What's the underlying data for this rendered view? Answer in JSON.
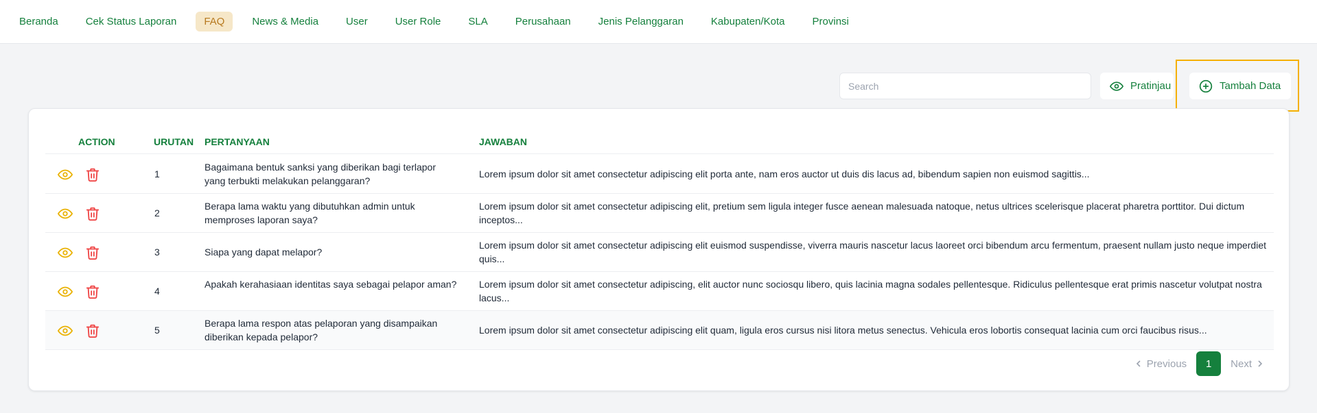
{
  "nav": {
    "items": [
      {
        "label": "Beranda"
      },
      {
        "label": "Cek Status Laporan"
      },
      {
        "label": "FAQ"
      },
      {
        "label": "News & Media"
      },
      {
        "label": "User"
      },
      {
        "label": "User Role"
      },
      {
        "label": "SLA"
      },
      {
        "label": "Perusahaan"
      },
      {
        "label": "Jenis Pelanggaran"
      },
      {
        "label": "Kabupaten/Kota"
      },
      {
        "label": "Provinsi"
      }
    ],
    "active_index": 2
  },
  "toolbar": {
    "search_placeholder": "Search",
    "search_value": "",
    "preview_label": "Pratinjau",
    "add_label": "Tambah Data"
  },
  "table": {
    "headers": {
      "action": "ACTION",
      "urutan": "URUTAN",
      "pertanyaan": "PERTANYAAN",
      "jawaban": "JAWABAN"
    },
    "rows": [
      {
        "no": "1",
        "question": "Bagaimana bentuk sanksi yang diberikan bagi terlapor yang terbukti melakukan pelanggaran?",
        "answer": "Lorem ipsum dolor sit amet consectetur adipiscing elit porta ante, nam eros auctor ut duis dis lacus ad, bibendum sapien non euismod sagittis..."
      },
      {
        "no": "2",
        "question": "Berapa lama waktu yang dibutuhkan admin untuk memproses laporan saya?",
        "answer": "Lorem ipsum dolor sit amet consectetur adipiscing elit, pretium sem ligula integer fusce aenean malesuada natoque, netus ultrices scelerisque placerat pharetra porttitor. Dui dictum inceptos..."
      },
      {
        "no": "3",
        "question": "Siapa yang dapat melapor?",
        "answer": "Lorem ipsum dolor sit amet consectetur adipiscing elit euismod suspendisse, viverra mauris nascetur lacus laoreet orci bibendum arcu fermentum, praesent nullam justo neque imperdiet quis..."
      },
      {
        "no": "4",
        "question": "Apakah kerahasiaan identitas saya sebagai pelapor aman?",
        "answer": "Lorem ipsum dolor sit amet consectetur adipiscing, elit auctor nunc sociosqu libero, quis lacinia magna sodales pellentesque. Ridiculus pellentesque erat primis nascetur volutpat nostra lacus..."
      },
      {
        "no": "5",
        "question": "Berapa lama respon atas pelaporan yang disampaikan diberikan kepada pelapor?",
        "answer": "Lorem ipsum dolor sit amet consectetur adipiscing elit quam, ligula eros cursus nisi litora metus senectus. Vehicula eros lobortis consequat lacinia cum orci faucibus risus..."
      }
    ],
    "row_icons": {
      "view": "eye-icon",
      "delete": "trash-icon"
    }
  },
  "pagination": {
    "previous_label": "Previous",
    "current_page": "1",
    "next_label": "Next"
  },
  "colors": {
    "accent": "#15803d",
    "active_tab_bg": "#f6e7c8",
    "active_tab_text": "#b7791f",
    "view_icon": "#eab308",
    "delete_icon": "#ef4444",
    "highlight_border": "#f5b000"
  }
}
